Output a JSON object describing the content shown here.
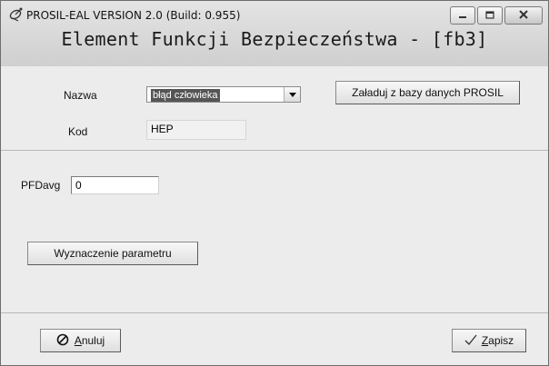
{
  "window": {
    "title": "PROSIL-EAL VERSION 2.0 (Build: 0.955)",
    "heading": "Element Funkcji Bezpieczeństwa - [fb3]"
  },
  "fields": {
    "nazwa_label": "Nazwa",
    "nazwa_value": "błąd człowieka",
    "kod_label": "Kod",
    "kod_value": "HEP",
    "pfdavg_label": "PFDavg",
    "pfdavg_value": "0"
  },
  "buttons": {
    "load_from_db": "Załaduj z bazy danych PROSIL",
    "determine_param": "Wyznaczenie parametru",
    "cancel_first": "A",
    "cancel_rest": "nuluj",
    "save_first": "Z",
    "save_rest": "apisz"
  },
  "icons": {
    "app": "satellite-dish-icon",
    "minimize": "minimize-icon",
    "maximize": "maximize-icon",
    "close": "close-icon",
    "dropdown": "chevron-down-icon",
    "cancel": "prohibited-icon",
    "save": "checkmark-icon"
  }
}
